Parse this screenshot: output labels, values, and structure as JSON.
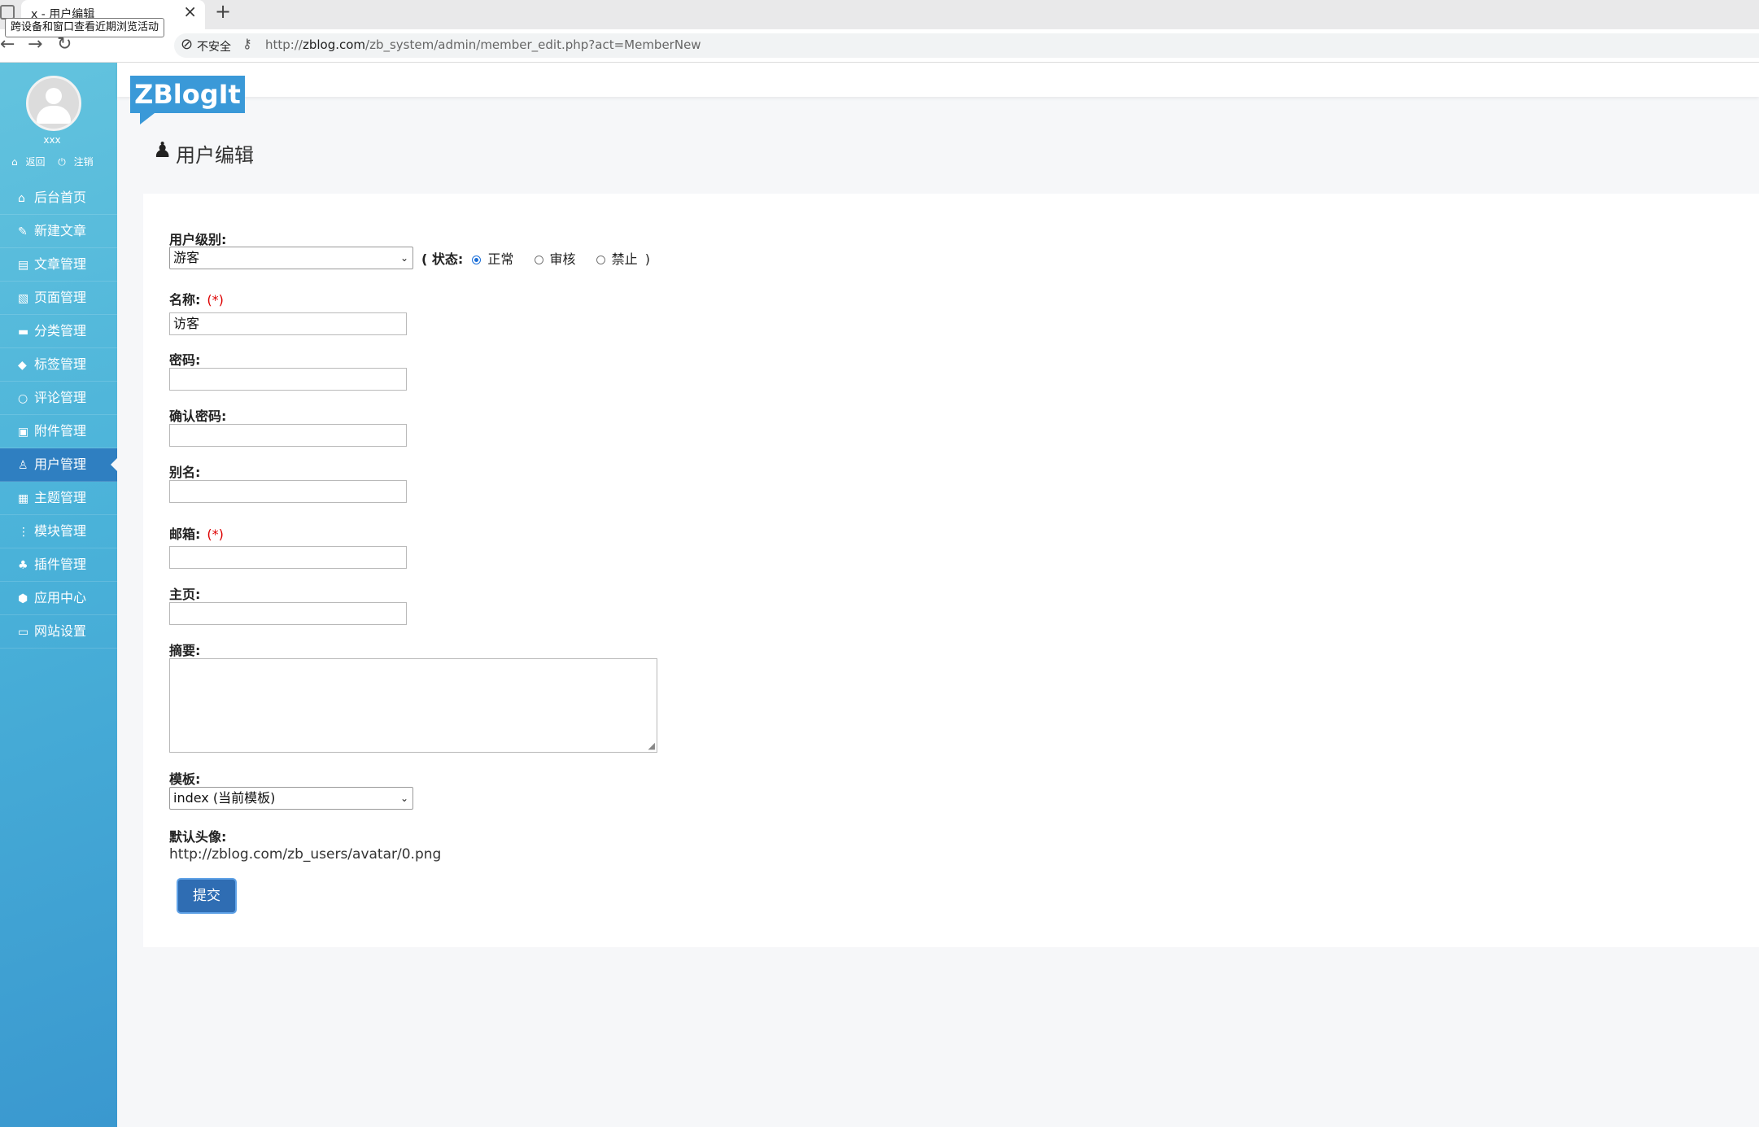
{
  "browser": {
    "tab_title": "x - 用户编辑",
    "tab_close": "×",
    "new_tab": "+",
    "tooltip": "跨设备和窗口查看近期浏览活动",
    "back": "←",
    "forward": "→",
    "reload": "↻",
    "security_label": "不安全",
    "url_scheme": "http://",
    "url_host": "zblog.com",
    "url_path": "/zb_system/admin/member_edit.php?act=MemberNew"
  },
  "sidebar": {
    "username": "xxx",
    "back_link": "返回",
    "logout_link": "注销",
    "items": [
      {
        "icon": "home-icon",
        "glyph": "⌂",
        "label": "后台首页"
      },
      {
        "icon": "new-post-icon",
        "glyph": "✎",
        "label": "新建文章"
      },
      {
        "icon": "articles-icon",
        "glyph": "▤",
        "label": "文章管理"
      },
      {
        "icon": "pages-icon",
        "glyph": "▧",
        "label": "页面管理"
      },
      {
        "icon": "folder-icon",
        "glyph": "▬",
        "label": "分类管理"
      },
      {
        "icon": "tag-icon",
        "glyph": "◆",
        "label": "标签管理"
      },
      {
        "icon": "comment-icon",
        "glyph": "○",
        "label": "评论管理"
      },
      {
        "icon": "attachment-icon",
        "glyph": "▣",
        "label": "附件管理"
      },
      {
        "icon": "user-icon",
        "glyph": "♙",
        "label": "用户管理"
      },
      {
        "icon": "theme-icon",
        "glyph": "▦",
        "label": "主题管理"
      },
      {
        "icon": "module-icon",
        "glyph": "⋮",
        "label": "模块管理"
      },
      {
        "icon": "plugin-icon",
        "glyph": "♣",
        "label": "插件管理"
      },
      {
        "icon": "app-center-icon",
        "glyph": "⬢",
        "label": "应用中心"
      },
      {
        "icon": "settings-icon",
        "glyph": "▭",
        "label": "网站设置"
      }
    ],
    "active_index": 8
  },
  "header": {
    "logo": "ZBlogIt",
    "page_title": "用户编辑"
  },
  "form": {
    "level_label": "用户级别:",
    "level_value": "游客",
    "status_open": "( 状态:",
    "status_options": [
      "正常",
      "审核",
      "禁止"
    ],
    "status_selected": "正常",
    "status_close": ")",
    "name_label": "名称:",
    "required_mark": "(*)",
    "name_value": "访客",
    "password_label": "密码:",
    "password_value": "",
    "confirm_label": "确认密码:",
    "confirm_value": "",
    "alias_label": "别名:",
    "alias_value": "",
    "email_label": "邮箱:",
    "email_value": "",
    "homepage_label": "主页:",
    "homepage_value": "",
    "intro_label": "摘要:",
    "template_label": "模板:",
    "template_value": "index (当前模板)",
    "avatar_label": "默认头像:",
    "avatar_url": "http://zblog.com/zb_users/avatar/0.png",
    "submit_label": "提交"
  },
  "colors": {
    "sidebar_top": "#63c3de",
    "sidebar_bottom": "#3a98cf",
    "active_item": "#2f7fc1",
    "logo_bg": "#3a99d8",
    "submit_bg": "#2f6db3",
    "required": "#dd0000"
  }
}
